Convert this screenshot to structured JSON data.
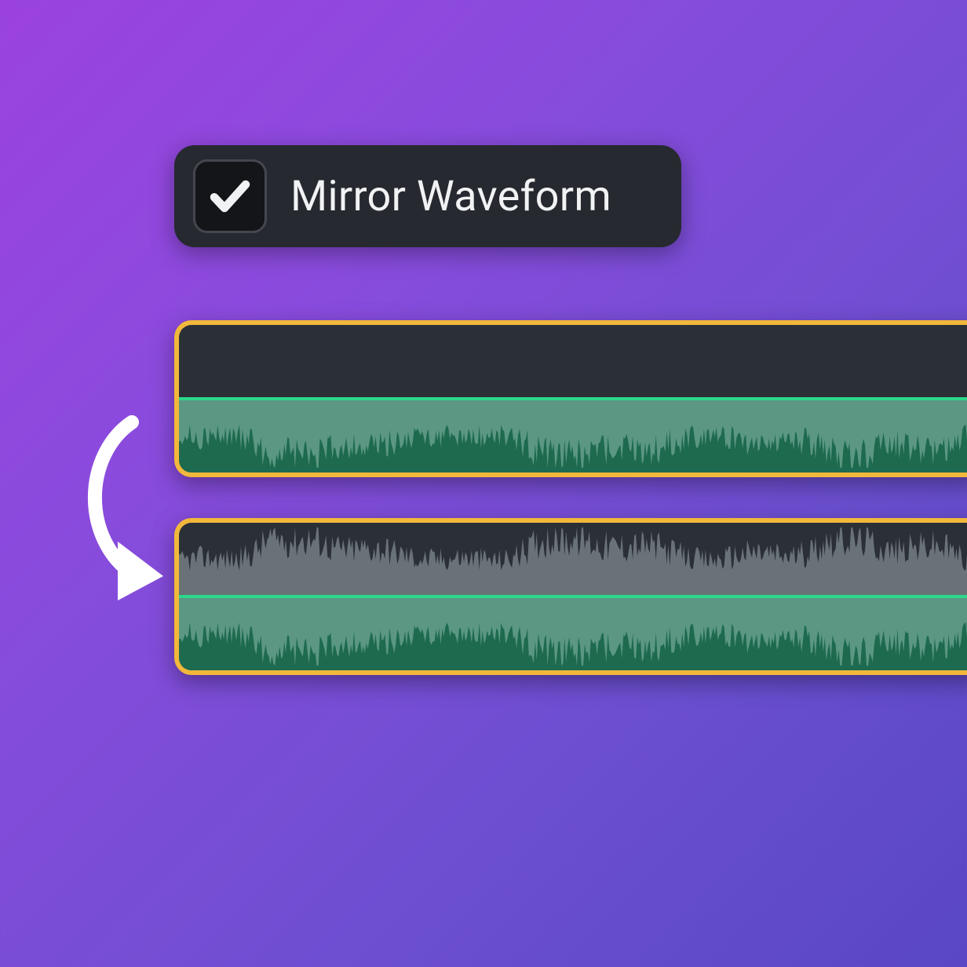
{
  "checkbox": {
    "label": "Mirror Waveform",
    "checked": true
  },
  "colors": {
    "panel_bg": "#26292F",
    "checkbox_bg": "#131518",
    "checkbox_border": "#44474E",
    "track_bg": "#2B3037",
    "track_border": "#F2B83B",
    "green_fill": "#1E6A4F",
    "centerline": "#2BD98A",
    "wave_bottom": "#5B9783",
    "wave_top": "#697277",
    "arrow": "#FFFFFF"
  },
  "tracks": {
    "top": {
      "mirror": false
    },
    "bottom": {
      "mirror": true
    }
  }
}
